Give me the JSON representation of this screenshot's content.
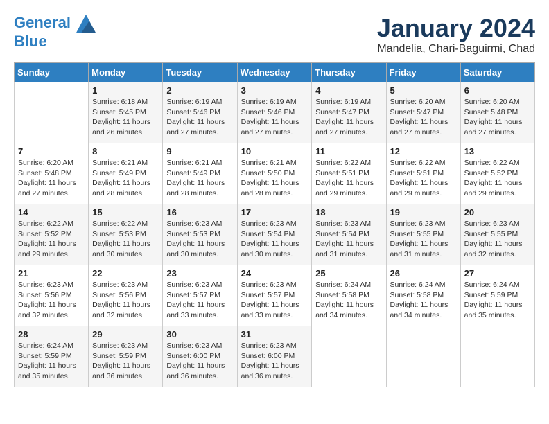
{
  "header": {
    "logo_line1": "General",
    "logo_line2": "Blue",
    "month": "January 2024",
    "location": "Mandelia, Chari-Baguirmi, Chad"
  },
  "days_of_week": [
    "Sunday",
    "Monday",
    "Tuesday",
    "Wednesday",
    "Thursday",
    "Friday",
    "Saturday"
  ],
  "weeks": [
    [
      {
        "day": "",
        "info": ""
      },
      {
        "day": "1",
        "info": "Sunrise: 6:18 AM\nSunset: 5:45 PM\nDaylight: 11 hours\nand 26 minutes."
      },
      {
        "day": "2",
        "info": "Sunrise: 6:19 AM\nSunset: 5:46 PM\nDaylight: 11 hours\nand 27 minutes."
      },
      {
        "day": "3",
        "info": "Sunrise: 6:19 AM\nSunset: 5:46 PM\nDaylight: 11 hours\nand 27 minutes."
      },
      {
        "day": "4",
        "info": "Sunrise: 6:19 AM\nSunset: 5:47 PM\nDaylight: 11 hours\nand 27 minutes."
      },
      {
        "day": "5",
        "info": "Sunrise: 6:20 AM\nSunset: 5:47 PM\nDaylight: 11 hours\nand 27 minutes."
      },
      {
        "day": "6",
        "info": "Sunrise: 6:20 AM\nSunset: 5:48 PM\nDaylight: 11 hours\nand 27 minutes."
      }
    ],
    [
      {
        "day": "7",
        "info": "Sunrise: 6:20 AM\nSunset: 5:48 PM\nDaylight: 11 hours\nand 27 minutes."
      },
      {
        "day": "8",
        "info": "Sunrise: 6:21 AM\nSunset: 5:49 PM\nDaylight: 11 hours\nand 28 minutes."
      },
      {
        "day": "9",
        "info": "Sunrise: 6:21 AM\nSunset: 5:49 PM\nDaylight: 11 hours\nand 28 minutes."
      },
      {
        "day": "10",
        "info": "Sunrise: 6:21 AM\nSunset: 5:50 PM\nDaylight: 11 hours\nand 28 minutes."
      },
      {
        "day": "11",
        "info": "Sunrise: 6:22 AM\nSunset: 5:51 PM\nDaylight: 11 hours\nand 29 minutes."
      },
      {
        "day": "12",
        "info": "Sunrise: 6:22 AM\nSunset: 5:51 PM\nDaylight: 11 hours\nand 29 minutes."
      },
      {
        "day": "13",
        "info": "Sunrise: 6:22 AM\nSunset: 5:52 PM\nDaylight: 11 hours\nand 29 minutes."
      }
    ],
    [
      {
        "day": "14",
        "info": "Sunrise: 6:22 AM\nSunset: 5:52 PM\nDaylight: 11 hours\nand 29 minutes."
      },
      {
        "day": "15",
        "info": "Sunrise: 6:22 AM\nSunset: 5:53 PM\nDaylight: 11 hours\nand 30 minutes."
      },
      {
        "day": "16",
        "info": "Sunrise: 6:23 AM\nSunset: 5:53 PM\nDaylight: 11 hours\nand 30 minutes."
      },
      {
        "day": "17",
        "info": "Sunrise: 6:23 AM\nSunset: 5:54 PM\nDaylight: 11 hours\nand 30 minutes."
      },
      {
        "day": "18",
        "info": "Sunrise: 6:23 AM\nSunset: 5:54 PM\nDaylight: 11 hours\nand 31 minutes."
      },
      {
        "day": "19",
        "info": "Sunrise: 6:23 AM\nSunset: 5:55 PM\nDaylight: 11 hours\nand 31 minutes."
      },
      {
        "day": "20",
        "info": "Sunrise: 6:23 AM\nSunset: 5:55 PM\nDaylight: 11 hours\nand 32 minutes."
      }
    ],
    [
      {
        "day": "21",
        "info": "Sunrise: 6:23 AM\nSunset: 5:56 PM\nDaylight: 11 hours\nand 32 minutes."
      },
      {
        "day": "22",
        "info": "Sunrise: 6:23 AM\nSunset: 5:56 PM\nDaylight: 11 hours\nand 32 minutes."
      },
      {
        "day": "23",
        "info": "Sunrise: 6:23 AM\nSunset: 5:57 PM\nDaylight: 11 hours\nand 33 minutes."
      },
      {
        "day": "24",
        "info": "Sunrise: 6:23 AM\nSunset: 5:57 PM\nDaylight: 11 hours\nand 33 minutes."
      },
      {
        "day": "25",
        "info": "Sunrise: 6:24 AM\nSunset: 5:58 PM\nDaylight: 11 hours\nand 34 minutes."
      },
      {
        "day": "26",
        "info": "Sunrise: 6:24 AM\nSunset: 5:58 PM\nDaylight: 11 hours\nand 34 minutes."
      },
      {
        "day": "27",
        "info": "Sunrise: 6:24 AM\nSunset: 5:59 PM\nDaylight: 11 hours\nand 35 minutes."
      }
    ],
    [
      {
        "day": "28",
        "info": "Sunrise: 6:24 AM\nSunset: 5:59 PM\nDaylight: 11 hours\nand 35 minutes."
      },
      {
        "day": "29",
        "info": "Sunrise: 6:23 AM\nSunset: 5:59 PM\nDaylight: 11 hours\nand 36 minutes."
      },
      {
        "day": "30",
        "info": "Sunrise: 6:23 AM\nSunset: 6:00 PM\nDaylight: 11 hours\nand 36 minutes."
      },
      {
        "day": "31",
        "info": "Sunrise: 6:23 AM\nSunset: 6:00 PM\nDaylight: 11 hours\nand 36 minutes."
      },
      {
        "day": "",
        "info": ""
      },
      {
        "day": "",
        "info": ""
      },
      {
        "day": "",
        "info": ""
      }
    ]
  ]
}
